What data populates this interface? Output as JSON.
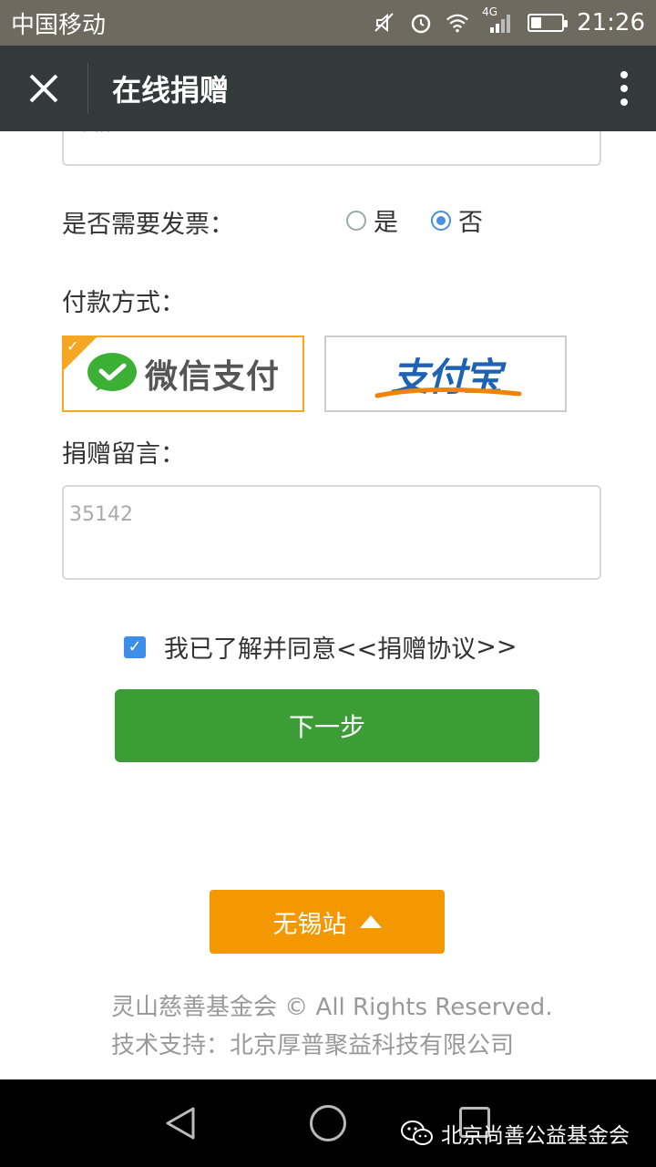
{
  "status_bar": {
    "carrier": "中国移动",
    "network": "4G",
    "time": "21:26",
    "battery_level": 0.35
  },
  "app_bar": {
    "title": "在线捐赠"
  },
  "form": {
    "email_placeholder": "邮箱",
    "invoice_label": "是否需要发票：",
    "invoice_options": [
      {
        "label": "是",
        "selected": false
      },
      {
        "label": "否",
        "selected": true
      }
    ],
    "payment_label": "付款方式：",
    "payment_options": [
      {
        "label": "微信支付",
        "selected": true
      },
      {
        "label": "支付宝",
        "selected": false
      }
    ],
    "message_label": "捐赠留言：",
    "message_value": "35142",
    "agree_prefix": "我已了解并同意<< ",
    "agree_link": "捐赠协议",
    "agree_suffix": ">>",
    "agree_checked": true,
    "next_label": "下一步"
  },
  "station": {
    "label": "无锡站"
  },
  "footer": {
    "line1": "灵山慈善基金会 © All Rights Reserved.",
    "line2": "技术支持：北京厚普聚益科技有限公司"
  },
  "watermark": {
    "text": "北京尚善公益基金会"
  },
  "colors": {
    "appbar": "#343a3a",
    "next_button": "#3c9c35",
    "station_button": "#f39800",
    "selected_border": "#f5a623",
    "radio_accent": "#4a90e2",
    "wechat_green": "#3cb034",
    "alipay_blue": "#1e62b4",
    "alipay_orange": "#f08300"
  },
  "icons": {
    "close": "close-icon",
    "more": "more-vertical-icon",
    "mute": "mute-icon",
    "alarm": "alarm-icon",
    "wifi": "wifi-icon",
    "signal": "signal-icon",
    "battery": "battery-icon",
    "check": "check-icon",
    "wechat": "wechat-pay-logo",
    "triangle_up": "triangle-up-icon",
    "back": "nav-back-icon",
    "home": "nav-home-icon",
    "recents": "nav-recents-icon",
    "wechat_watermark": "wechat-icon"
  }
}
